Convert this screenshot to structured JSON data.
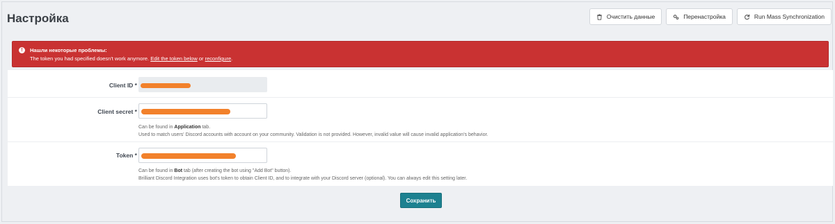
{
  "page": {
    "title": "Настройка"
  },
  "toolbar": {
    "clear_label": "Очистить данные",
    "reconfigure_label": "Перенастройка",
    "sync_label": "Run Mass Synchronization"
  },
  "alert": {
    "title": "Нашли некоторые проблемы:",
    "body_prefix": "The token you had specified doesn't work anymore.",
    "edit_link": "Edit the token below",
    "or_text": "or",
    "reconfigure_link": "reconfigure",
    "suffix": "."
  },
  "form": {
    "client_id": {
      "label": "Client ID *"
    },
    "client_secret": {
      "label": "Client secret *",
      "help_prefix": "Can be found in",
      "help_bold": "Application",
      "help_suffix": "tab.",
      "help_line2": "Used to match users' Discord accounts with account on your community. Validation is not provided. However, invalid value will cause invalid application's behavior."
    },
    "token": {
      "label": "Token *",
      "help_prefix": "Can be found in",
      "help_bold": "Bot",
      "help_suffix": "tab (after creating the bot using \"Add Bot\" button).",
      "help_line2": "Brilliant Discord Integration uses bot's token to obtain Client ID, and to integrate with your Discord server (optional). You can always edit this setting later."
    }
  },
  "save_label": "Сохранить",
  "colors": {
    "alert": "#c93232",
    "primary": "#1d8190",
    "redaction": "#f2812b"
  }
}
